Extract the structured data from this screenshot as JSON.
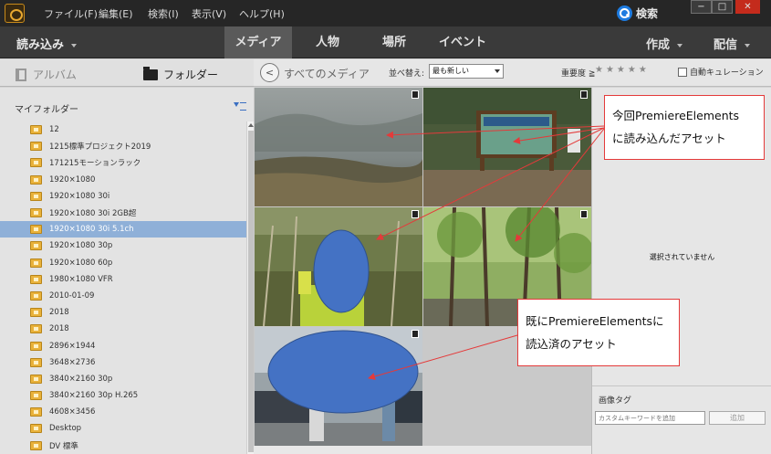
{
  "menubar": {
    "items": [
      "ファイル(F)",
      "編集(E)",
      "検索(I)",
      "表示(V)",
      "ヘルプ(H)"
    ],
    "search_label": "検索",
    "window_controls": [
      "−",
      "□",
      "✕"
    ]
  },
  "toolbar": {
    "import_label": "読み込み",
    "tabs": [
      "メディア",
      "人物",
      "場所",
      "イベント"
    ],
    "active_tab": "メディア",
    "create_label": "作成",
    "share_label": "配信"
  },
  "left_tabs": {
    "album_label": "アルバム",
    "folder_label": "フォルダー"
  },
  "folders": {
    "title": "マイフォルダー",
    "items": [
      "12",
      "1215標準プロジェクト2019",
      "171215モーションラック",
      "1920×1080",
      "1920×1080 30i",
      "1920×1080 30i 2GB超",
      "1920×1080 30i 5.1ch",
      "1920×1080 30p",
      "1920×1080 60p",
      "1980×1080 VFR",
      "2010-01-09",
      "2018",
      "2018",
      "2896×1944",
      "3648×2736",
      "3840×2160 30p",
      "3840×2160 30p H.265",
      "4608×3456",
      "Desktop",
      "DV 標準"
    ],
    "selected": "1920×1080 30i 5.1ch"
  },
  "media_header": {
    "back_glyph": "<",
    "all_media_label": "すべてのメディア",
    "sort_label": "並べ替え:",
    "sort_value": "最も新しい",
    "rating_label": "重要度",
    "rating_op": "≧",
    "stars": "★★★★★",
    "auto_curation_label": "自動キュレーション"
  },
  "right_panel": {
    "none_selected": "選択されていません",
    "tags_label": "画像タグ",
    "keyword_placeholder": "カスタムキーワードを追加",
    "add_label": "追加"
  },
  "callouts": {
    "new_line1": "今回PremiereElements",
    "new_line2": "に読み込んだアセット",
    "old_line1": "既にPremiereElementsに",
    "old_line2": "読込済のアセット"
  },
  "colors": {
    "accent": "#1d7be0",
    "callout_border": "#e43a3a",
    "selected_row": "#8fb0d8"
  }
}
